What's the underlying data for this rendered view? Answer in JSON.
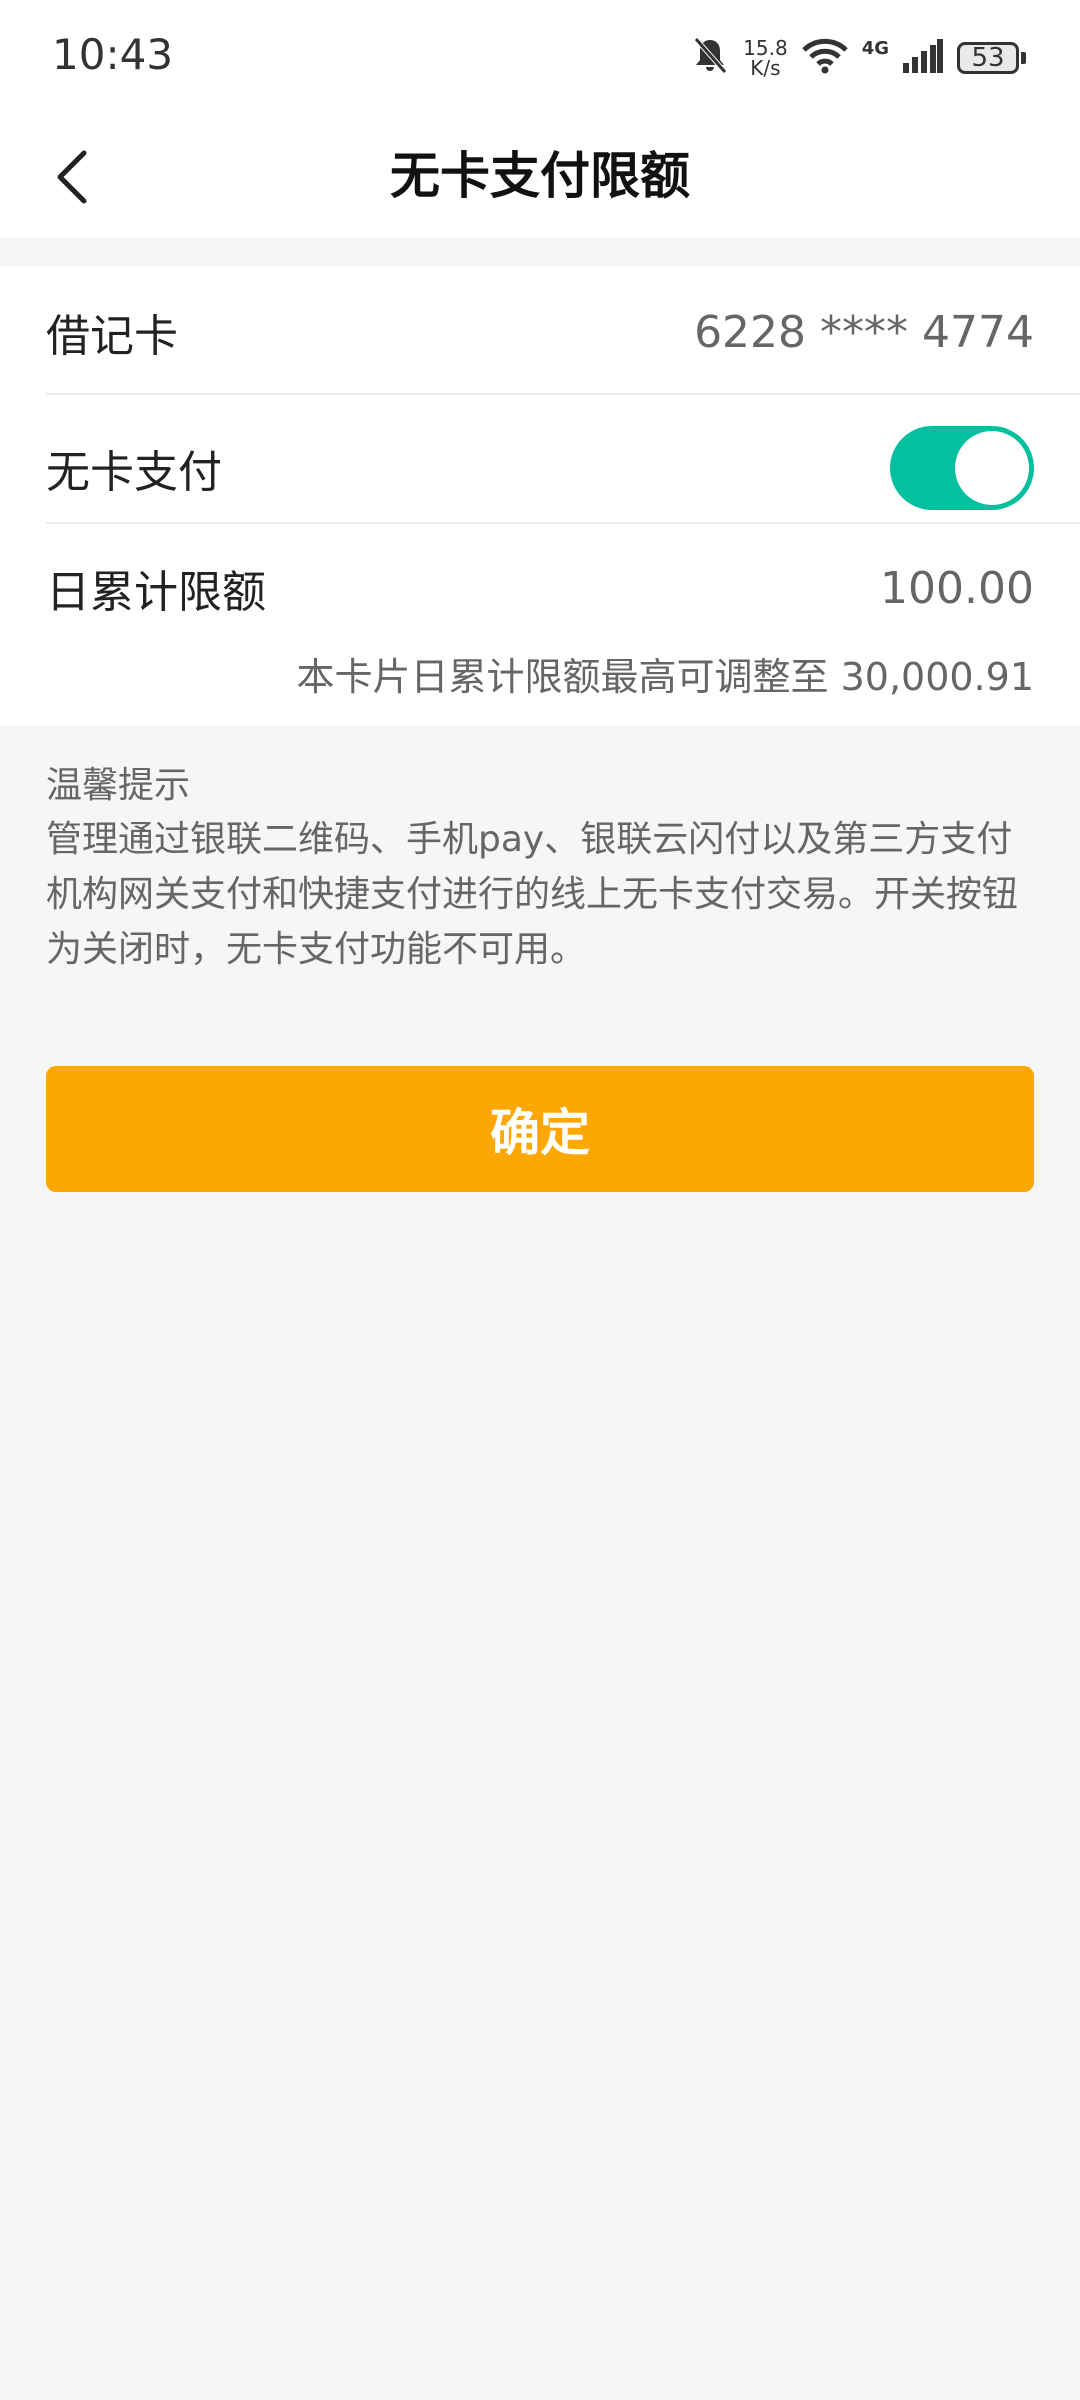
{
  "status_bar": {
    "time": "10:43",
    "net_speed_value": "15.8",
    "net_speed_unit": "K/s",
    "net_type": "4G",
    "battery": "53",
    "icons": [
      "bell-off-icon",
      "wifi-icon",
      "signal-icon",
      "battery-icon"
    ]
  },
  "nav": {
    "title": "无卡支付限额",
    "back_icon": "chevron-left-icon"
  },
  "card": {
    "debit_label": "借记卡",
    "debit_number": "6228 **** 4774",
    "cardless_label": "无卡支付",
    "cardless_enabled": true,
    "daily_limit_label": "日累计限额",
    "daily_limit_value": "100.00",
    "limit_hint": "本卡片日累计限额最高可调整至 30,000.91"
  },
  "tips": {
    "title": "温馨提示",
    "text": "管理通过银联二维码、手机pay、银联云闪付以及第三方支付机构网关支付和快捷支付进行的线上无卡支付交易。开关按钮为关闭时，无卡支付功能不可用。"
  },
  "confirm_label": "确定",
  "colors": {
    "accent": "#fda705",
    "toggle_on": "#04c09f",
    "background": "#f6f6f6"
  }
}
